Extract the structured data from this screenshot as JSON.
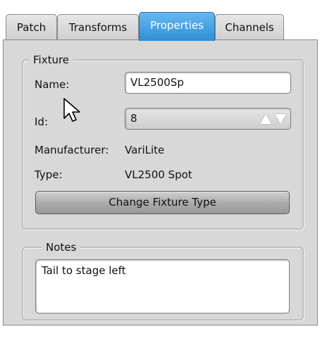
{
  "tabs": [
    {
      "label": "Patch",
      "active": false
    },
    {
      "label": "Transforms",
      "active": false
    },
    {
      "label": "Properties",
      "active": true
    },
    {
      "label": "Channels",
      "active": false
    }
  ],
  "fixture": {
    "legend": "Fixture",
    "name_label": "Name:",
    "name_value": "VL2500Sp",
    "id_label": "Id:",
    "id_value": "8",
    "manufacturer_label": "Manufacturer:",
    "manufacturer_value": "VariLite",
    "type_label": "Type:",
    "type_value": "VL2500 Spot",
    "change_button": "Change Fixture Type"
  },
  "notes": {
    "legend": "Notes",
    "text": "Tail to stage left"
  },
  "colors": {
    "active_tab": "#3d9be0",
    "panel_bg": "#d8d8d8"
  },
  "icons": {
    "cursor": "mouse-pointer-icon",
    "spin_up": "arrow-up-icon",
    "spin_down": "arrow-down-icon"
  }
}
